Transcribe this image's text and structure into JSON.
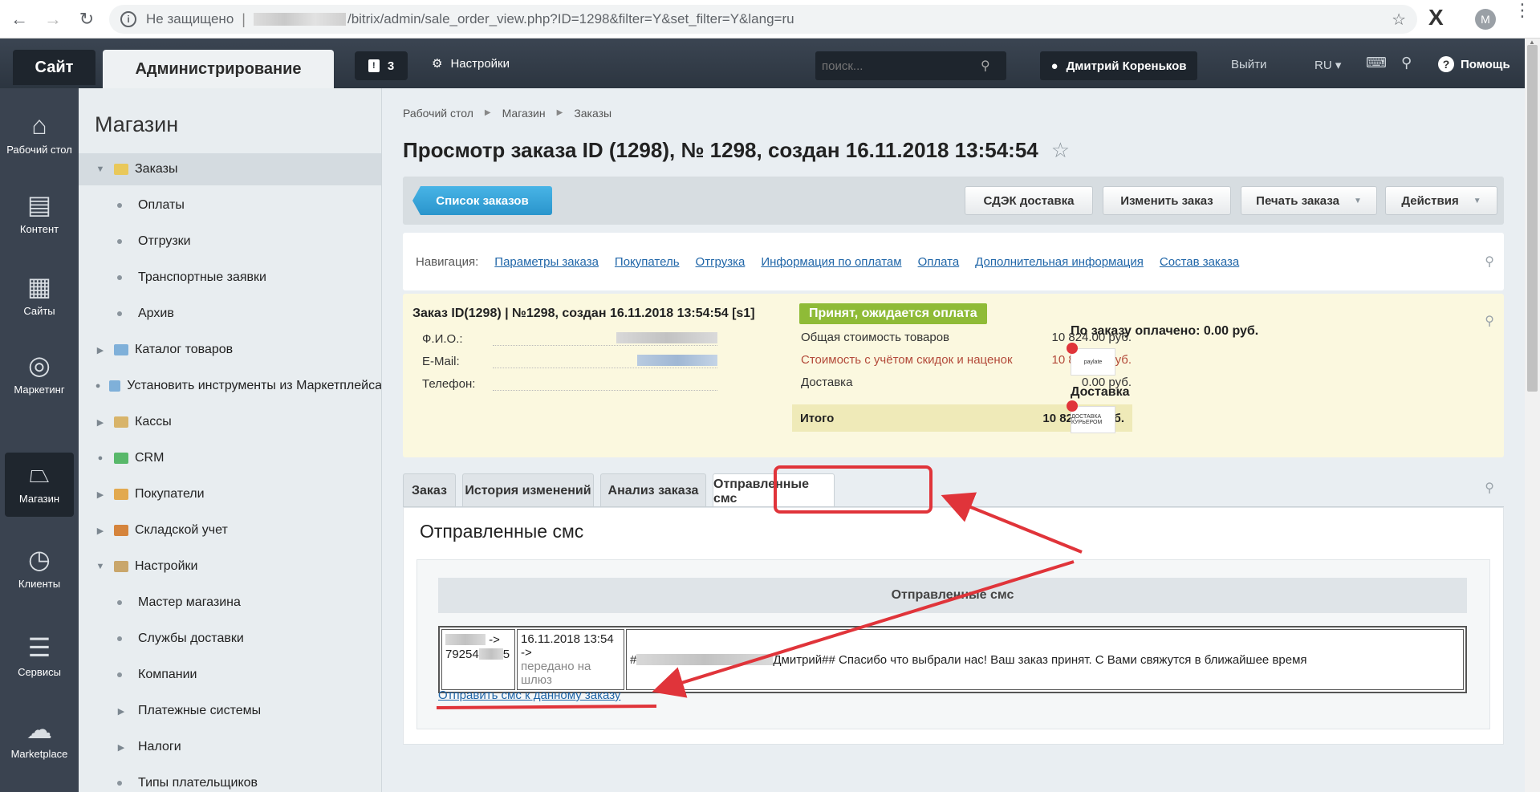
{
  "browser": {
    "insecure_label": "Не защищено",
    "url": "/bitrix/admin/sale_order_view.php?ID=1298&filter=Y&set_filter=Y&lang=ru",
    "profile_initial": "M",
    "ext_letter": "X"
  },
  "topbar": {
    "site_label": "Сайт",
    "admin_label": "Администрирование",
    "notif_count": "3",
    "settings_label": "Настройки",
    "search_placeholder": "поиск...",
    "user_name": "Дмитрий Кореньков",
    "logout": "Выйти",
    "lang": "RU",
    "help": "Помощь"
  },
  "rail": [
    {
      "label": "Рабочий стол"
    },
    {
      "label": "Контент"
    },
    {
      "label": "Сайты"
    },
    {
      "label": "Маркетинг"
    },
    {
      "label": "Магазин"
    },
    {
      "label": "Клиенты"
    },
    {
      "label": "Сервисы"
    },
    {
      "label": "Marketplace"
    }
  ],
  "menu": {
    "title": "Магазин",
    "items": [
      {
        "label": "Заказы"
      },
      {
        "label": "Оплаты"
      },
      {
        "label": "Отгрузки"
      },
      {
        "label": "Транспортные заявки"
      },
      {
        "label": "Архив"
      },
      {
        "label": "Каталог товаров"
      },
      {
        "label": "Установить инструменты из Маркетплейса"
      },
      {
        "label": "Кассы"
      },
      {
        "label": "CRM"
      },
      {
        "label": "Покупатели"
      },
      {
        "label": "Складской учет"
      },
      {
        "label": "Настройки"
      },
      {
        "label": "Мастер магазина"
      },
      {
        "label": "Службы доставки"
      },
      {
        "label": "Компании"
      },
      {
        "label": "Платежные системы"
      },
      {
        "label": "Налоги"
      },
      {
        "label": "Типы плательщиков"
      }
    ]
  },
  "breadcrumb": [
    "Рабочий стол",
    "Магазин",
    "Заказы"
  ],
  "page_title": "Просмотр заказа ID (1298), № 1298, создан 16.11.2018 13:54:54",
  "toolbar": {
    "list_orders": "Список заказов",
    "cdek": "СДЭК доставка",
    "edit_order": "Изменить заказ",
    "print_order": "Печать заказа",
    "actions": "Действия"
  },
  "nav": {
    "label": "Навигация:",
    "links": [
      "Параметры заказа",
      "Покупатель",
      "Отгрузка",
      "Информация по оплатам",
      "Оплата",
      "Дополнительная информация",
      "Состав заказа"
    ]
  },
  "summary": {
    "heading": "Заказ ID(1298) | №1298, создан 16.11.2018 13:54:54 [s1]",
    "status": "Принят, ожидается оплата",
    "fio_label": "Ф.И.О.:",
    "email_label": "E-Mail:",
    "phone_label": "Телефон:",
    "goods_cost_label": "Общая стоимость товаров",
    "goods_cost": "10 824.00 руб.",
    "discount_cost_label": "Стоимость с учётом скидок и наценок",
    "discount_cost": "10 824.00 руб.",
    "delivery_label": "Доставка",
    "delivery_cost": "0.00 руб.",
    "total_label": "Итого",
    "total": "10 824.00 руб.",
    "paid": "По заказу оплачено: 0.00 руб.",
    "delivery_side": "Доставка",
    "logo1": "paylate",
    "logo2": "ДОСТАВКА КУРЬЕРОМ"
  },
  "tabs": [
    "Заказ",
    "История изменений",
    "Анализ заказа",
    "Отправленные смс"
  ],
  "sms": {
    "title": "Отправленные смс",
    "table_title": "Отправленные смс",
    "row": {
      "from": "->",
      "to": "79254",
      "to_suffix": "5",
      "date": "16.11.2018 13:54 ->",
      "status": "передано на шлюз",
      "message_prefix": "#",
      "message": "Дмитрий## Спасибо что выбрали нас! Ваш заказ принят. С Вами свяжутся в ближайшее время"
    },
    "send_link": "Отправить смс к данному заказу"
  },
  "colors": {
    "accent_blue": "#2a95cc",
    "status_green": "#8fbb37",
    "annotation_red": "#e0343a"
  }
}
